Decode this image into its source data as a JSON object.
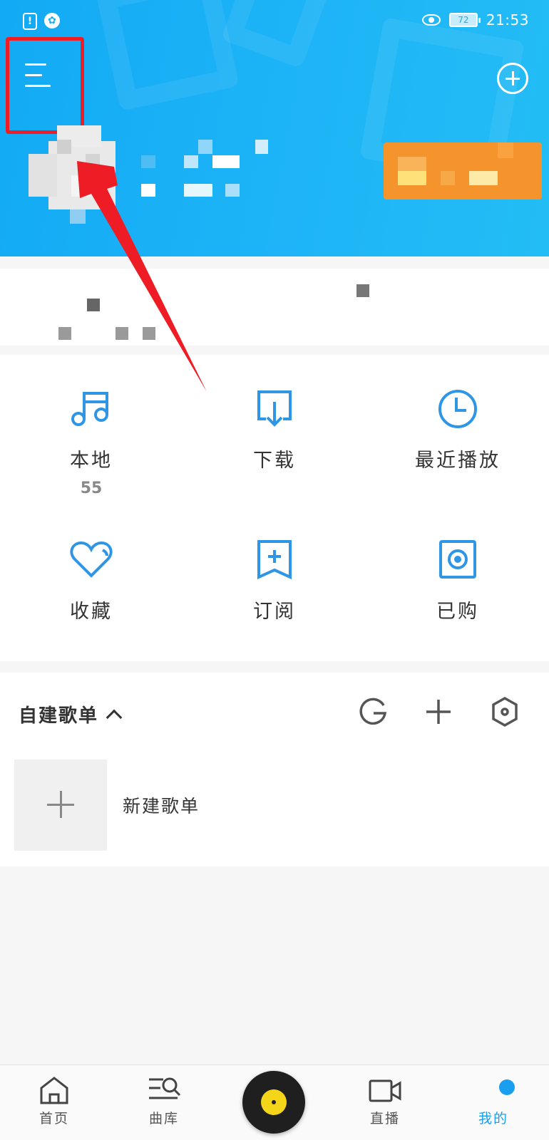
{
  "status_bar": {
    "battery": "72",
    "time": "21:53"
  },
  "grid": [
    {
      "label": "本地",
      "count": "55",
      "icon": "music-note-icon"
    },
    {
      "label": "下载",
      "icon": "download-icon"
    },
    {
      "label": "最近播放",
      "icon": "clock-icon"
    },
    {
      "label": "收藏",
      "icon": "heart-icon"
    },
    {
      "label": "订阅",
      "icon": "bookmark-plus-icon"
    },
    {
      "label": "已购",
      "icon": "purchased-disc-icon"
    }
  ],
  "playlist": {
    "title": "自建歌单",
    "new_label": "新建歌单"
  },
  "bottom_nav": [
    {
      "label": "首页",
      "icon": "home-icon"
    },
    {
      "label": "曲库",
      "icon": "library-search-icon"
    },
    {
      "label": "直播",
      "icon": "video-camera-icon"
    },
    {
      "label": "我的",
      "icon": "profile-icon"
    }
  ],
  "colors": {
    "accent": "#1a9ef0",
    "header_blue": "#19aef4",
    "highlight_red": "#ee1c24",
    "vip_orange": "#f5942c"
  }
}
